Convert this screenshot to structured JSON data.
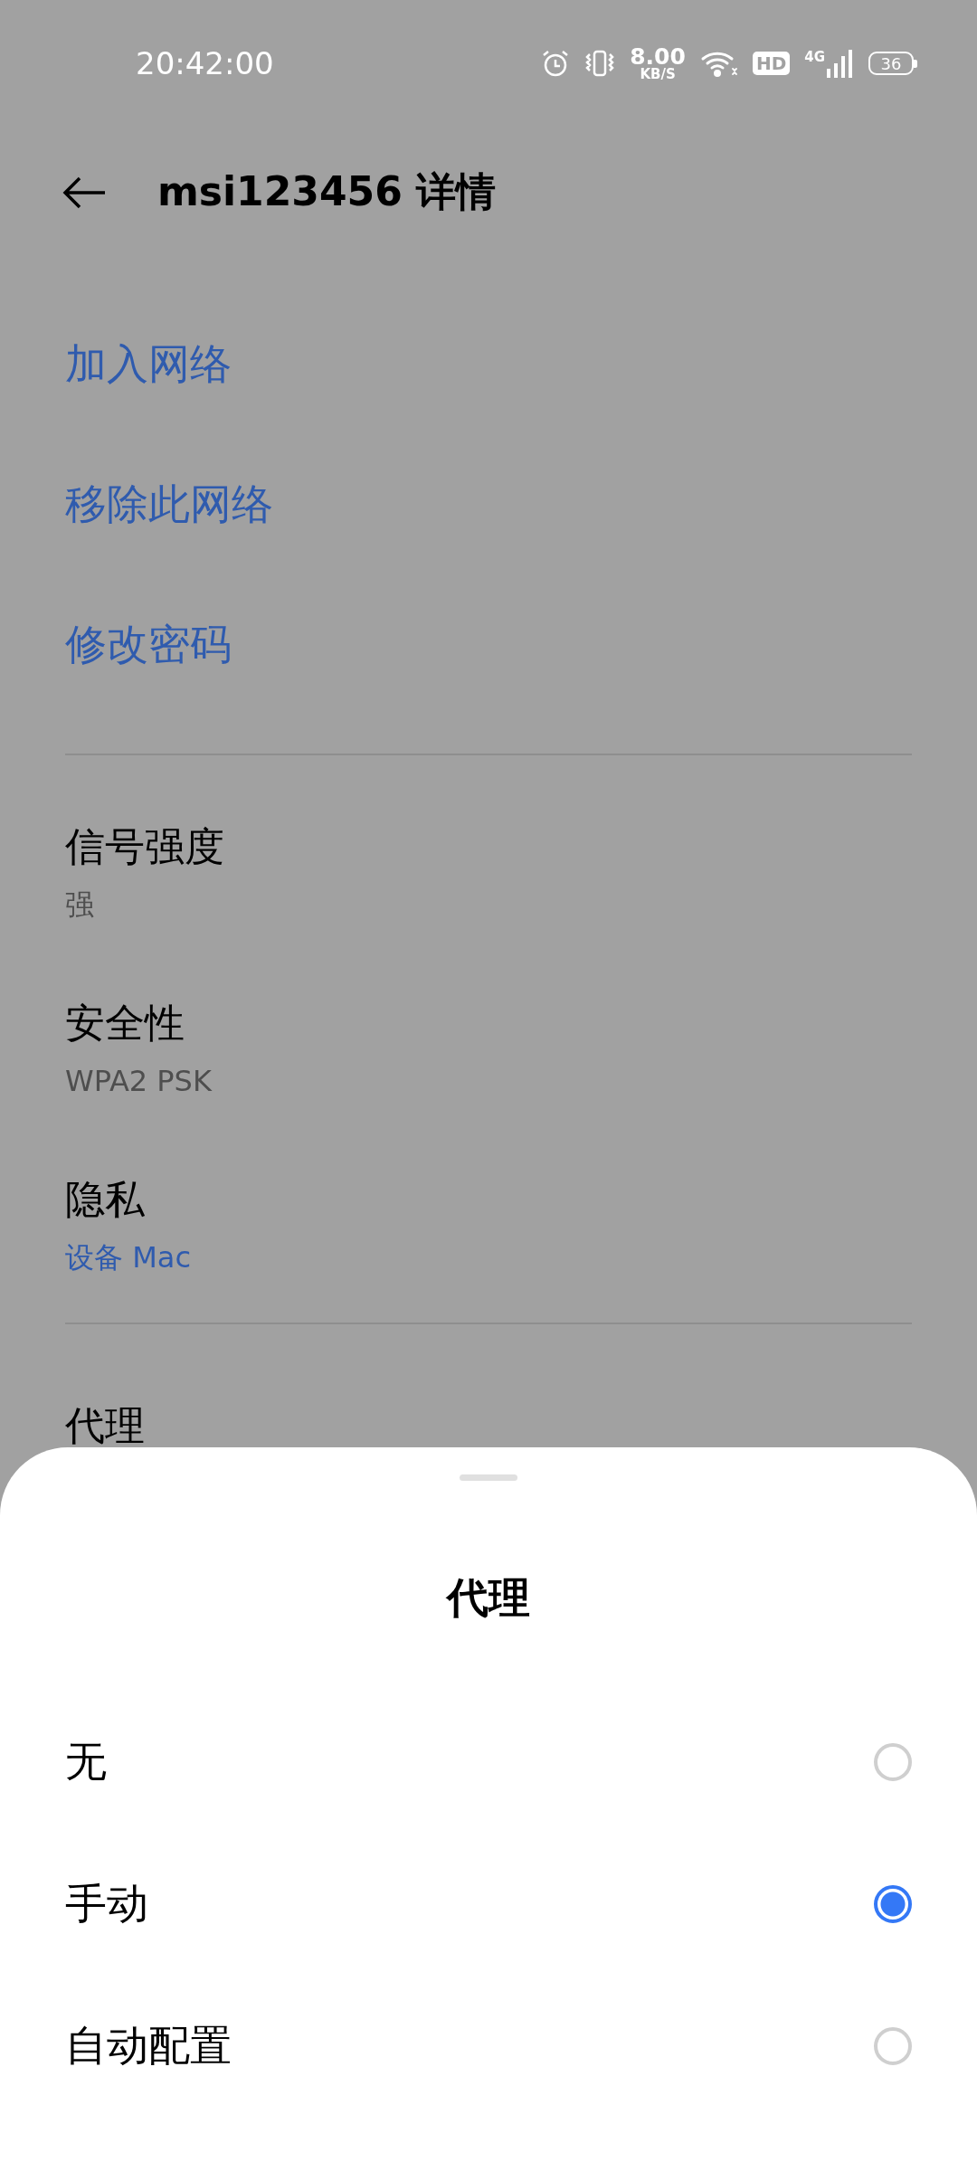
{
  "status_bar": {
    "time": "20:42:00",
    "net_speed": "8.00",
    "net_speed_unit": "KB/S",
    "hd_label": "HD",
    "network_type": "4G",
    "battery": "36"
  },
  "header": {
    "title": "msi123456 详情"
  },
  "actions": [
    {
      "label": "加入网络"
    },
    {
      "label": "移除此网络"
    },
    {
      "label": "修改密码"
    }
  ],
  "details": [
    {
      "label": "信号强度",
      "value": "强",
      "kind": "plain"
    },
    {
      "label": "安全性",
      "value": "WPA2 PSK",
      "kind": "plain"
    },
    {
      "label": "隐私",
      "value": "设备 Mac",
      "kind": "link"
    }
  ],
  "proxy_row": {
    "label": "代理"
  },
  "sheet": {
    "title": "代理",
    "options": [
      {
        "label": "无",
        "selected": false
      },
      {
        "label": "手动",
        "selected": true
      },
      {
        "label": "自动配置",
        "selected": false
      }
    ]
  }
}
